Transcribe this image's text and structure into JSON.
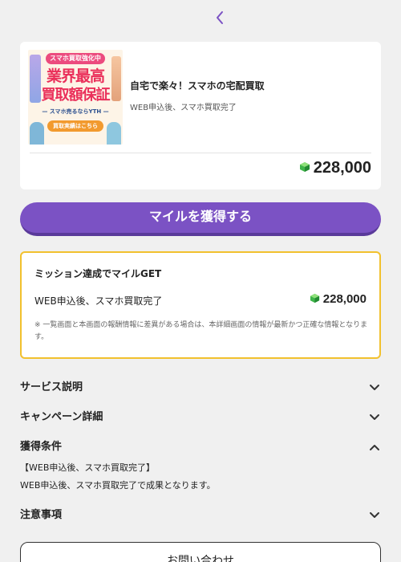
{
  "nav": {
    "back_icon": "chevron-left-icon",
    "accent_color": "#7b52c4"
  },
  "offer": {
    "banner": {
      "ribbon": "スマホ買取強化中",
      "headline_line1": "業界最高",
      "headline_line2": "買取額保証",
      "subline": "— スマホ売るならYTH —",
      "cta": "買取実績はこちら"
    },
    "title": "自宅で楽々！スマホの宅配買取",
    "subtitle": "WEB申込後、スマホ買取完了",
    "points": "228,000",
    "points_icon": "mile-gem-icon"
  },
  "get_button": {
    "label": "マイルを獲得する"
  },
  "mission": {
    "title": "ミッション達成でマイルGET",
    "row_label": "WEB申込後、スマホ買取完了",
    "points": "228,000",
    "note": "※ 一覧画面と本画面の報酬情報に差異がある場合は、本詳細画面の情報が最新かつ正確な情報となります。",
    "border_color": "#f2c12e"
  },
  "accordions": [
    {
      "label": "サービス説明",
      "state": "collapsed"
    },
    {
      "label": "キャンペーン詳細",
      "state": "collapsed"
    },
    {
      "label": "獲得条件",
      "state": "expanded"
    },
    {
      "label": "注意事項",
      "state": "collapsed"
    }
  ],
  "conditions": {
    "line1": "【WEB申込後、スマホ買取完了】",
    "line2": "WEB申込後、スマホ買取完了で成果となります。"
  },
  "contact_button": {
    "label": "お問い合わせ"
  }
}
